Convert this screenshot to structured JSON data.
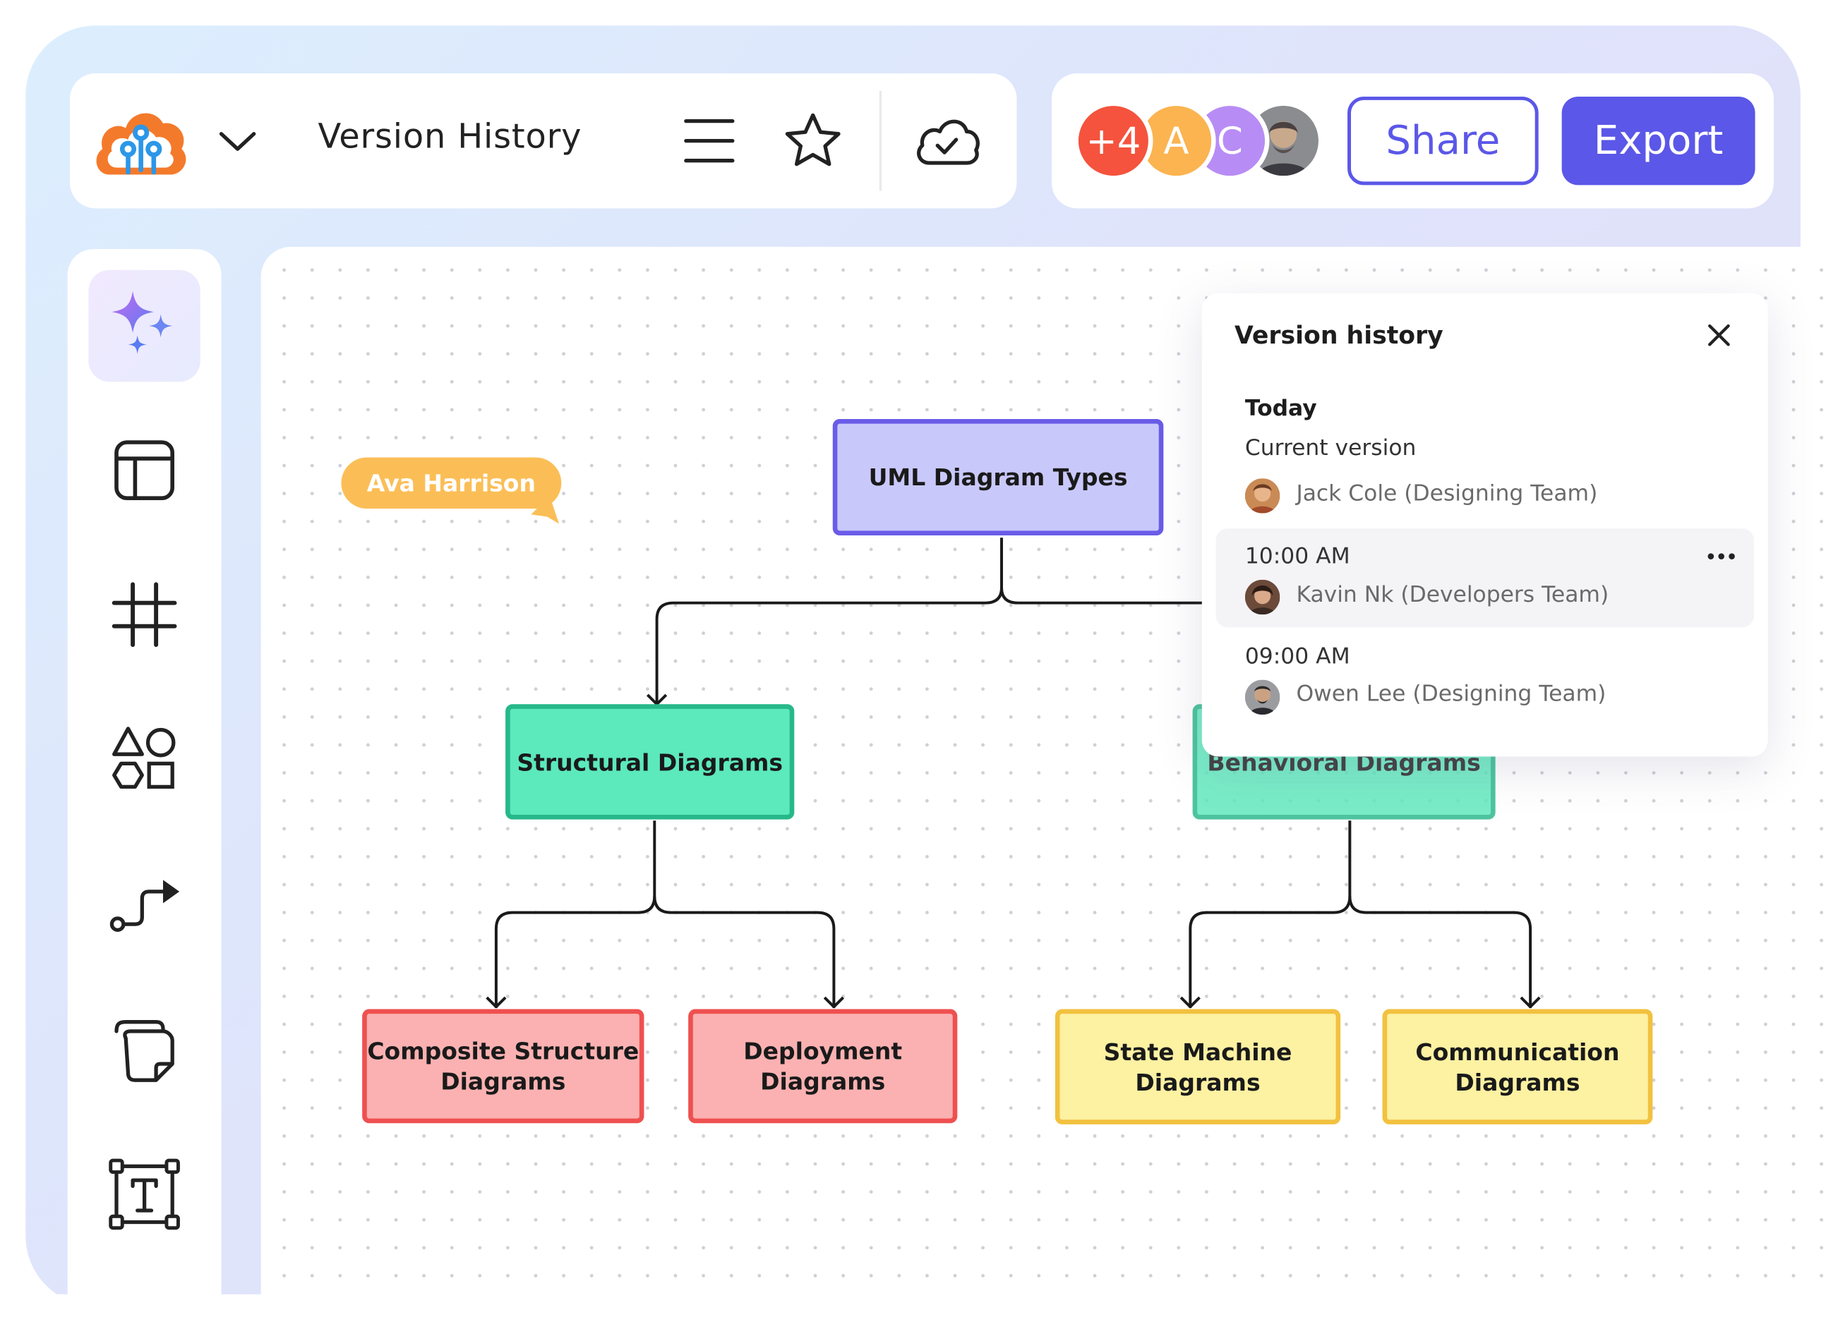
{
  "header": {
    "title": "Version History"
  },
  "collaborators": {
    "overflow_count": "+4",
    "initials": [
      "A",
      "C"
    ],
    "colors": {
      "overflow": "#f5533d",
      "a": "#fbb450",
      "c": "#b88cf5"
    }
  },
  "actions": {
    "share_label": "Share",
    "export_label": "Export"
  },
  "sidebar": {
    "tools": [
      "ai-sparkle-icon",
      "template-icon",
      "grid-icon",
      "shapes-icon",
      "connector-icon",
      "sticky-note-icon",
      "text-icon"
    ]
  },
  "canvas": {
    "cursor_user": "Ava Harrison",
    "nodes": {
      "root": "UML Diagram Types",
      "structural": "Structural Diagrams",
      "behavioral": "Behavioral Diagrams",
      "composite": "Composite Structure\nDiagrams",
      "deployment": "Deployment\nDiagrams",
      "state_machine": "State Machine\nDiagrams",
      "communication": "Communication\nDiagrams"
    }
  },
  "version_panel": {
    "title": "Version history",
    "group_heading": "Today",
    "versions": [
      {
        "label": "Current version",
        "user": "Jack Cole (Designing Team)"
      },
      {
        "label": "10:00 AM",
        "user": "Kavin Nk (Developers Team)"
      },
      {
        "label": "09:00 AM",
        "user": "Owen Lee (Designing Team)"
      }
    ]
  },
  "colors": {
    "accent": "#5b57e8",
    "root_fill": "#c9c8fb",
    "green_fill": "#5ce9bb",
    "red_fill": "#fbb1b1",
    "yellow_fill": "#fdf1a2",
    "cursor_tag": "#fbbe57"
  }
}
